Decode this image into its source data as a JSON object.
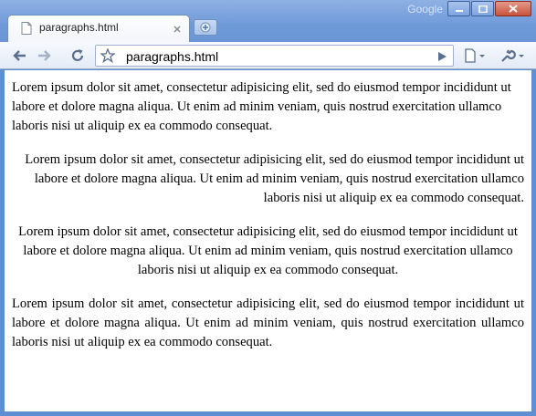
{
  "window": {
    "brand": "Google",
    "controls": [
      "minimize-icon",
      "maximize-icon",
      "close-icon"
    ]
  },
  "tab": {
    "title": "paragraphs.html",
    "favicon": "page-icon",
    "close_icon": "close-icon",
    "new_tab_icon": "plus-icon"
  },
  "toolbar": {
    "back_icon": "back-arrow-icon",
    "forward_icon": "forward-arrow-icon",
    "reload_icon": "reload-icon",
    "bookmark_icon": "star-icon",
    "url": "paragraphs.html",
    "go_icon": "play-icon",
    "page_menu_icon": "page-menu-icon",
    "wrench_menu_icon": "wrench-icon"
  },
  "page": {
    "paragraphs": [
      {
        "align": "left",
        "text": "Lorem ipsum dolor sit amet, consectetur adipisicing elit, sed do eiusmod tempor incididunt ut labore et dolore magna aliqua. Ut enim ad minim veniam, quis nostrud exercitation ullamco laboris nisi ut aliquip ex ea commodo consequat."
      },
      {
        "align": "right",
        "text": "Lorem ipsum dolor sit amet, consectetur adipisicing elit, sed do eiusmod tempor incididunt ut labore et dolore magna aliqua. Ut enim ad minim veniam, quis nostrud exercitation ullamco laboris nisi ut aliquip ex ea commodo consequat."
      },
      {
        "align": "center",
        "text": "Lorem ipsum dolor sit amet, consectetur adipisicing elit, sed do eiusmod tempor incididunt ut labore et dolore magna aliqua. Ut enim ad minim veniam, quis nostrud exercitation ullamco laboris nisi ut aliquip ex ea commodo consequat."
      },
      {
        "align": "justify",
        "text": "Lorem ipsum dolor sit amet, consectetur adipisicing elit, sed do eiusmod tempor incididunt ut labore et dolore magna aliqua. Ut enim ad minim veniam, quis nostrud exercitation ullamco laboris nisi ut aliquip ex ea commodo consequat."
      }
    ]
  },
  "colors": {
    "frame": "#6f9ad9",
    "toolbar": "#e4ebf6",
    "content_bg": "#ffffff",
    "text": "#000000"
  }
}
